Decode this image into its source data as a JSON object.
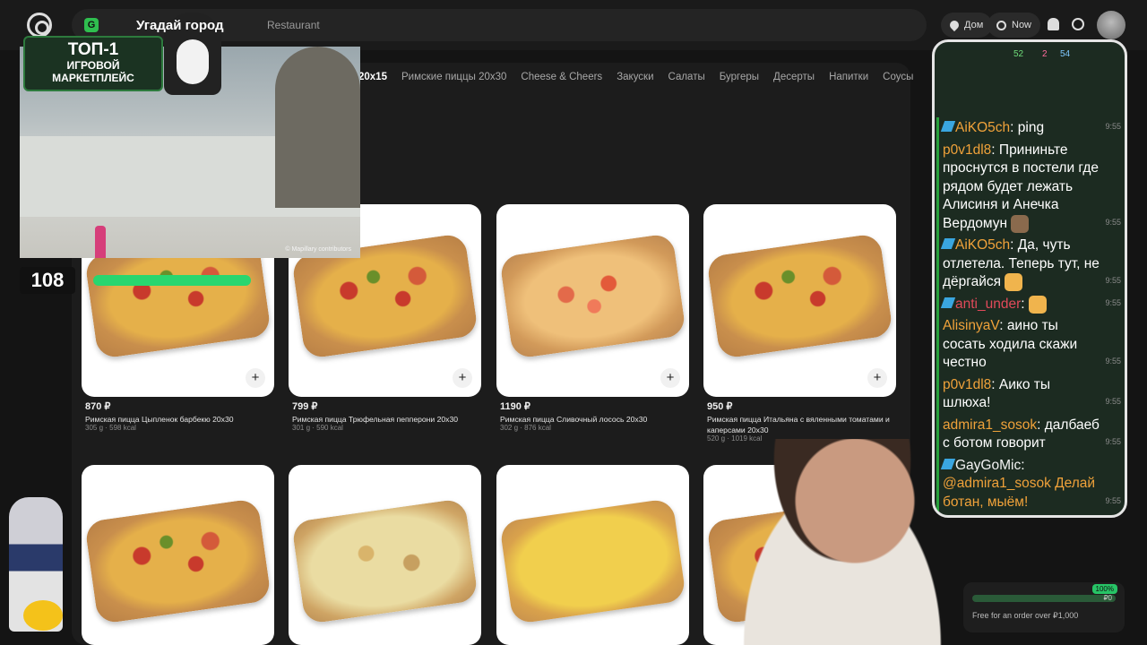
{
  "header": {
    "search_text": "Restaurant",
    "game_title": "Угадай город",
    "address_label": "Дом",
    "time_label": "Now"
  },
  "categories": [
    {
      "label": "20x15",
      "active": true
    },
    {
      "label": "Римские пиццы 20x30",
      "active": false
    },
    {
      "label": "Cheese & Cheers",
      "active": false
    },
    {
      "label": "Закуски",
      "active": false
    },
    {
      "label": "Салаты",
      "active": false
    },
    {
      "label": "Бургеры",
      "active": false
    },
    {
      "label": "Десерты",
      "active": false
    },
    {
      "label": "Напитки",
      "active": false
    },
    {
      "label": "Соусы",
      "active": false
    }
  ],
  "products": [
    {
      "price": "870 ₽",
      "name": "Римская пицца Цыпленок барбекю 20x30",
      "meta": "305 g · 598 kcal"
    },
    {
      "price": "799 ₽",
      "name": "Римская пицца Трюфельная пепперони 20x30",
      "meta": "301 g · 590 kcal"
    },
    {
      "price": "1190 ₽",
      "name": "Римская пицца Сливочный лосось 20x30",
      "meta": "302 g · 876 kcal"
    },
    {
      "price": "950 ₽",
      "name": "Римская пицца Итальяна с вяленными томатами и каперсами 20x30",
      "meta": "520 g · 1019 kcal"
    }
  ],
  "stream": {
    "promo_line1": "ТОП-1",
    "promo_line2": "ИГРОВОЙ",
    "promo_line3": "МАРКЕТПЛЕЙС",
    "counter": "108",
    "map_credit": "© Mapillary contributors",
    "phone_stats": {
      "s1": "52",
      "s2": "2",
      "s3": "54"
    }
  },
  "chat": [
    {
      "user": "AiKO5ch",
      "color": "#f0a23a",
      "text": "ping",
      "time": "9:55",
      "badge": true
    },
    {
      "user": "p0v1dl8",
      "color": "#f0a23a",
      "text": "Прининьте проснутся в постели где рядом будет лежать Алисиня и Анечка Вердомун",
      "time": "9:55",
      "badge": false,
      "emote": "brown"
    },
    {
      "user": "AiKO5ch",
      "color": "#f0a23a",
      "text": "Да, чуть отлетела. Теперь тут, не дёргайся",
      "time": "9:55",
      "badge": true,
      "emote": "cat"
    },
    {
      "user": "anti_under",
      "color": "#e04a5a",
      "text": "",
      "time": "9:55",
      "badge": true,
      "emote": "cat"
    },
    {
      "user": "AlisinyaV",
      "color": "#f0a23a",
      "text": "аино ты сосать ходила скажи честно",
      "time": "9:55",
      "badge": false
    },
    {
      "user": "p0v1dl8",
      "color": "#f0a23a",
      "text": "Аико ты шлюха!",
      "time": "9:55",
      "badge": false
    },
    {
      "user": "admira1_sosok",
      "color": "#f0a23a",
      "text": "далбаеб с ботом говорит",
      "time": "9:55",
      "badge": false
    },
    {
      "user": "GayGoMic",
      "color": "#f4f4f4",
      "text": "@admira1_sosok Делай ботан, мыём!",
      "time": "9:55",
      "badge": true
    }
  ],
  "delivery": {
    "pct": "100%",
    "p0": "₽0",
    "text": "Free for an order over ₽1,000"
  }
}
